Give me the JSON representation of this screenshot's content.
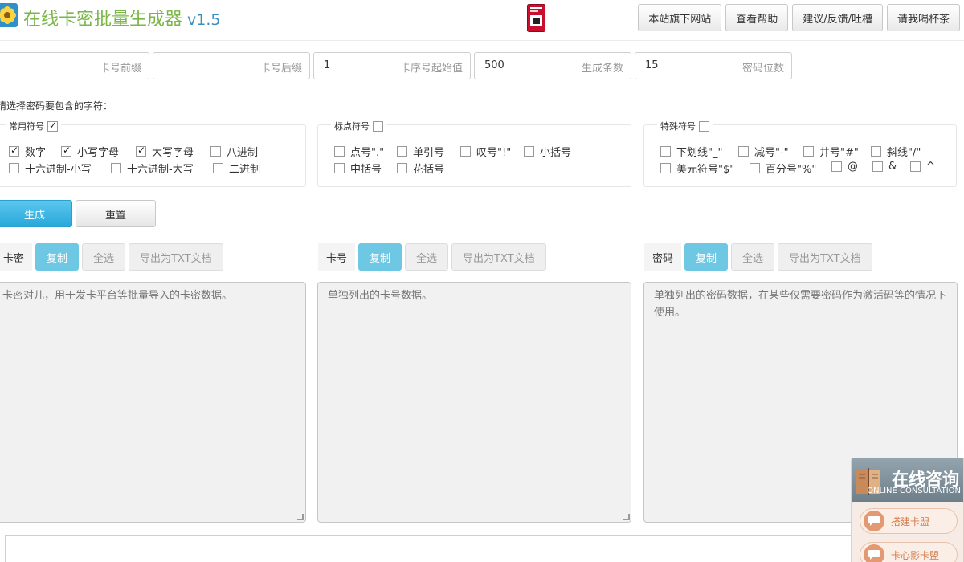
{
  "app": {
    "title": "在线卡密批量生成器",
    "version": "v1.5"
  },
  "nav": [
    "本站旗下网站",
    "查看帮助",
    "建议/反馈/吐槽",
    "请我喝杯茶"
  ],
  "fields": [
    {
      "label": "卡号前缀",
      "value": ""
    },
    {
      "label": "卡号后缀",
      "value": ""
    },
    {
      "label": "卡序号起始值",
      "value": "1"
    },
    {
      "label": "生成条数",
      "value": "500"
    },
    {
      "label": "密码位数",
      "value": "15"
    }
  ],
  "charset_prompt": "请选择密码要包含的字符：",
  "groups": {
    "common": {
      "title": "常用符号",
      "checked": true,
      "options": [
        {
          "label": "数字",
          "checked": true
        },
        {
          "label": "小写字母",
          "checked": true
        },
        {
          "label": "大写字母",
          "checked": true
        },
        {
          "label": "八进制",
          "checked": false
        },
        {
          "label": "十六进制-小写",
          "checked": false
        },
        {
          "label": "十六进制-大写",
          "checked": false
        },
        {
          "label": "二进制",
          "checked": false
        }
      ]
    },
    "punct": {
      "title": "标点符号",
      "checked": false,
      "options": [
        {
          "label": "点号\".\"",
          "checked": false
        },
        {
          "label": "单引号",
          "checked": false
        },
        {
          "label": "叹号\"!\"",
          "checked": false
        },
        {
          "label": "小括号",
          "checked": false
        },
        {
          "label": "中括号",
          "checked": false
        },
        {
          "label": "花括号",
          "checked": false
        }
      ]
    },
    "special": {
      "title": "特殊符号",
      "checked": false,
      "options": [
        {
          "label": "下划线\"_\"",
          "checked": false
        },
        {
          "label": "减号\"-\"",
          "checked": false
        },
        {
          "label": "井号\"#\"",
          "checked": false
        },
        {
          "label": "斜线\"/\"",
          "checked": false
        },
        {
          "label": "美元符号\"$\"",
          "checked": false
        },
        {
          "label": "百分号\"%\"",
          "checked": false
        },
        {
          "label": "@",
          "checked": false
        },
        {
          "label": "&",
          "checked": false
        },
        {
          "label": "^",
          "checked": false
        }
      ]
    }
  },
  "actions": {
    "generate": "生成",
    "reset": "重置"
  },
  "panels": [
    {
      "label": "卡密",
      "copy": "复制",
      "select_all": "全选",
      "export": "导出为TXT文档",
      "placeholder": "卡密对儿，用于发卡平台等批量导入的卡密数据。"
    },
    {
      "label": "卡号",
      "copy": "复制",
      "select_all": "全选",
      "export": "导出为TXT文档",
      "placeholder": "单独列出的卡号数据。"
    },
    {
      "label": "密码",
      "copy": "复制",
      "select_all": "全选",
      "export": "导出为TXT文档",
      "placeholder": "单独列出的密码数据，在某些仅需要密码作为激活码等的情况下使用。"
    }
  ],
  "consult": {
    "title": "在线咨询",
    "subtitle": "ONLINE CONSULTATION",
    "items": [
      "搭建卡盟",
      "卡心影卡盟"
    ]
  },
  "colors": {
    "title_green": "#7ab648",
    "version_blue": "#3a8fbf",
    "primary": "#28a8da",
    "copy_btn": "#6fc8e3"
  },
  "icons": [
    "flower-logo-icon",
    "playing-card-icon",
    "checkbox-icon",
    "resize-grip-icon",
    "book-icon",
    "chat-bubble-icon"
  ]
}
